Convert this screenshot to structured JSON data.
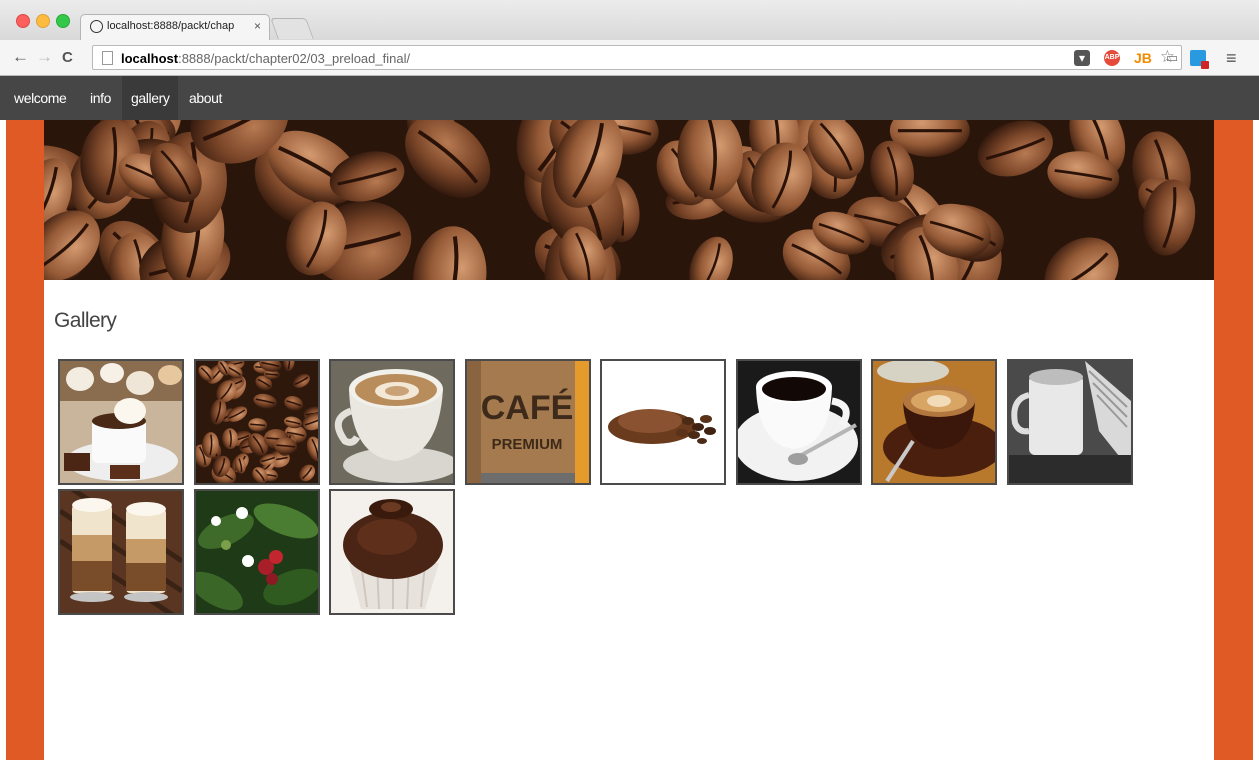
{
  "browser": {
    "tab_title": "localhost:8888/packt/chap",
    "tab_close": "×",
    "url_host": "localhost",
    "url_path": ":8888/packt/chapter02/03_preload_final/",
    "extensions": [
      "pocket-icon",
      "adblock-plus-icon",
      "jetbrains-icon",
      "cast-icon",
      "picture-icon"
    ],
    "abp_label": "ABP",
    "jb_label": "JB"
  },
  "nav": {
    "items": [
      "welcome",
      "info",
      "gallery",
      "about"
    ],
    "active": "gallery"
  },
  "gallery": {
    "title": "Gallery",
    "images": [
      "meringue-and-coffee",
      "coffee-beans",
      "latte-art-cup",
      "cafe-premium-cup",
      "ground-coffee-pile",
      "black-coffee-cup",
      "latte-on-saucer",
      "mug-and-newspaper",
      "two-latte-glasses",
      "coffee-plant",
      "chocolate-muffin"
    ],
    "cafe_label": "CAFÉ",
    "premium_label": "PREMIUM"
  },
  "colors": {
    "accent": "#e05a26",
    "nav_bg": "#464646",
    "border": "#4b4b4b"
  }
}
